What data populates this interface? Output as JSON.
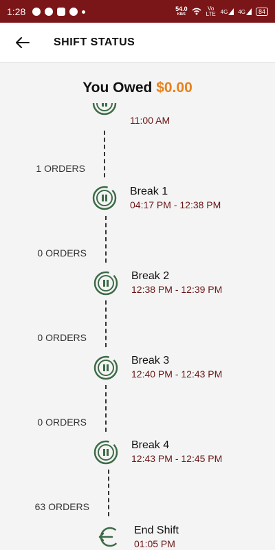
{
  "status_bar": {
    "time": "1:28",
    "speed_value": "54.0",
    "speed_unit": "KB/S",
    "network": "Vo LTE",
    "signal1": "4G",
    "signal2": "4G",
    "battery": "84"
  },
  "header": {
    "title": "SHIFT STATUS"
  },
  "owed": {
    "label": "You Owed",
    "amount": "$0.00"
  },
  "timeline": {
    "first_time": "11:00 AM",
    "gaps": [
      {
        "orders": "1 ORDERS"
      },
      {
        "orders": "0 ORDERS"
      },
      {
        "orders": "0 ORDERS"
      },
      {
        "orders": "0 ORDERS"
      },
      {
        "orders": "63 ORDERS"
      }
    ],
    "breaks": [
      {
        "title": "Break 1",
        "time": "04:17 PM - 12:38 PM"
      },
      {
        "title": "Break 2",
        "time": "12:38 PM - 12:39 PM"
      },
      {
        "title": "Break 3",
        "time": "12:40 PM - 12:43 PM"
      },
      {
        "title": "Break 4",
        "time": "12:43 PM - 12:45 PM"
      }
    ],
    "end": {
      "title": "End Shift",
      "time": "01:05 PM"
    }
  },
  "colors": {
    "bar": "#7a1518",
    "accent": "#e8811b",
    "icon": "#3d6b47",
    "time": "#6a1515"
  }
}
